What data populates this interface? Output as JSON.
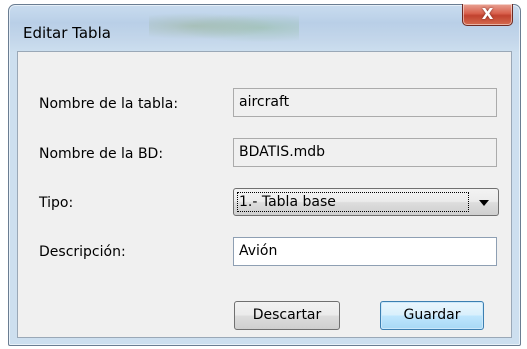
{
  "window": {
    "title": "Editar Tabla",
    "close_glyph": "X"
  },
  "form": {
    "table_name": {
      "label": "Nombre de la tabla:",
      "value": "aircraft"
    },
    "db_name": {
      "label": "Nombre de la BD:",
      "value": "BDATIS.mdb"
    },
    "type": {
      "label": "Tipo:",
      "selected": "1.- Tabla base"
    },
    "description": {
      "label": "Descripción:",
      "value": "Avión"
    }
  },
  "buttons": {
    "discard": "Descartar",
    "save": "Guardar"
  },
  "colors": {
    "close_button": "#c7432f",
    "frame": "#b9cfe7",
    "client_bg": "#f0f0f0",
    "default_button_border": "#3c7fb1"
  },
  "icons": {
    "close": "close-icon",
    "dropdown": "chevron-down-icon"
  }
}
